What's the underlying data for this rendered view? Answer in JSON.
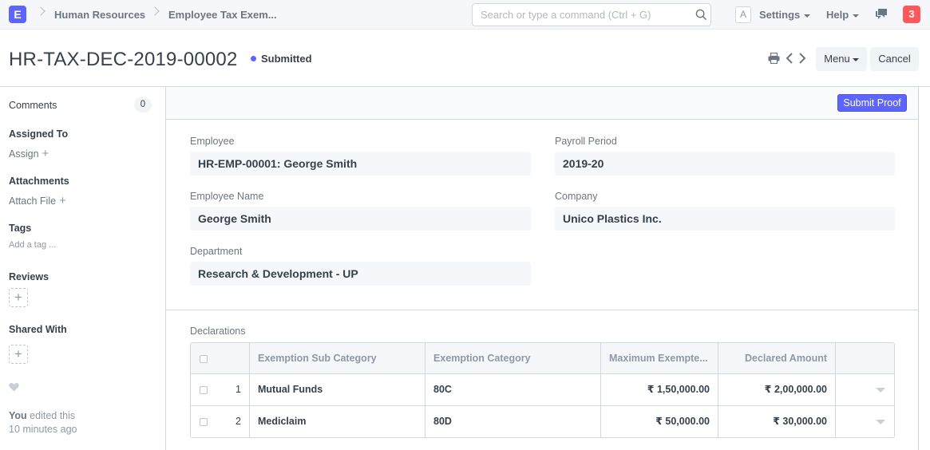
{
  "navbar": {
    "logo": "E",
    "breadcrumbs": [
      "Human Resources",
      "Employee Tax Exem..."
    ],
    "search_placeholder": "Search or type a command (Ctrl + G)",
    "avatar": "A",
    "settings_label": "Settings",
    "help_label": "Help",
    "notification_count": "3"
  },
  "page": {
    "title": "HR-TAX-DEC-2019-00002",
    "status": "Submitted",
    "status_color": "#5e64ff",
    "menu_label": "Menu",
    "cancel_label": "Cancel"
  },
  "sidebar": {
    "comments_label": "Comments",
    "comments_count": "0",
    "assigned_to_label": "Assigned To",
    "assign_link": "Assign",
    "attachments_label": "Attachments",
    "attach_link": "Attach File",
    "tags_label": "Tags",
    "add_tag_link": "Add a tag ...",
    "reviews_label": "Reviews",
    "shared_with_label": "Shared With",
    "edit_user": "You",
    "edit_action": "edited this",
    "edit_time": "10 minutes ago"
  },
  "form": {
    "submit_proof_label": "Submit Proof",
    "employee_label": "Employee",
    "employee_value": "HR-EMP-00001: George Smith",
    "employee_name_label": "Employee Name",
    "employee_name_value": "George Smith",
    "department_label": "Department",
    "department_value": "Research & Development - UP",
    "payroll_period_label": "Payroll Period",
    "payroll_period_value": "2019-20",
    "company_label": "Company",
    "company_value": "Unico Plastics Inc."
  },
  "declarations": {
    "section_label": "Declarations",
    "columns": [
      "Exemption Sub Category",
      "Exemption Category",
      "Maximum Exempte...",
      "Declared Amount"
    ],
    "rows": [
      {
        "index": "1",
        "sub_category": "Mutual Funds",
        "category": "80C",
        "max_exempted": "₹ 1,50,000.00",
        "declared": "₹ 2,00,000.00"
      },
      {
        "index": "2",
        "sub_category": "Mediclaim",
        "category": "80D",
        "max_exempted": "₹ 50,000.00",
        "declared": "₹ 30,000.00"
      }
    ]
  }
}
